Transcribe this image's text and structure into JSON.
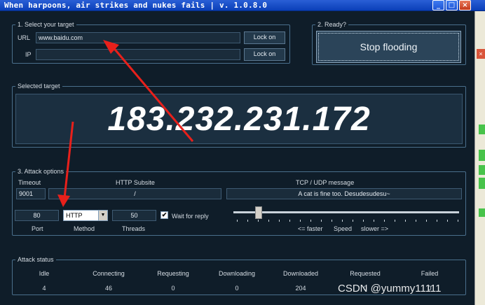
{
  "window": {
    "title": "When harpoons, air strikes and nukes fails | v. 1.0.8.0",
    "minimize_icon": "minimize-icon",
    "maximize_icon": "maximize-icon",
    "close_icon": "close-icon",
    "min_glyph": "_",
    "max_glyph": "□",
    "close_glyph": "×"
  },
  "target": {
    "legend": "1. Select your target",
    "url_label": "URL",
    "url_value": "www.baidu.com",
    "ip_label": "IP",
    "ip_value": "",
    "lock_url_label": "Lock on",
    "lock_ip_label": "Lock on"
  },
  "ready": {
    "legend": "2. Ready?",
    "button_label": "Stop flooding"
  },
  "selected": {
    "legend": "Selected target",
    "ip": "183.232.231.172"
  },
  "attack": {
    "legend": "3. Attack options",
    "timeout_label": "Timeout",
    "timeout_value": "9001",
    "subsite_label": "HTTP Subsite",
    "subsite_value": "/",
    "message_label": "TCP / UDP message",
    "message_value": "A cat is fine too. Desudesudesu~",
    "port_value": "80",
    "port_label": "Port",
    "method_value": "HTTP",
    "method_label": "Method",
    "threads_value": "50",
    "threads_label": "Threads",
    "wait_label": "Wait for reply",
    "wait_checked": true,
    "wait_check_glyph": "✔",
    "speed_faster": "<= faster",
    "speed_label": "Speed",
    "speed_slower": "slower =>",
    "speed_level": 0.1
  },
  "status": {
    "legend": "Attack status",
    "columns": [
      {
        "label": "Idle",
        "value": "4"
      },
      {
        "label": "Connecting",
        "value": "46"
      },
      {
        "label": "Requesting",
        "value": "0"
      },
      {
        "label": "Downloading",
        "value": "0"
      },
      {
        "label": "Downloaded",
        "value": "204"
      },
      {
        "label": "Requested",
        "value": "0"
      },
      {
        "label": "Failed",
        "value": "0"
      }
    ]
  },
  "watermark": "CSDN @yummy11111",
  "annotation_color": "#e8201b",
  "select_arrow_glyph": "▼",
  "edge_close_glyph": "×"
}
